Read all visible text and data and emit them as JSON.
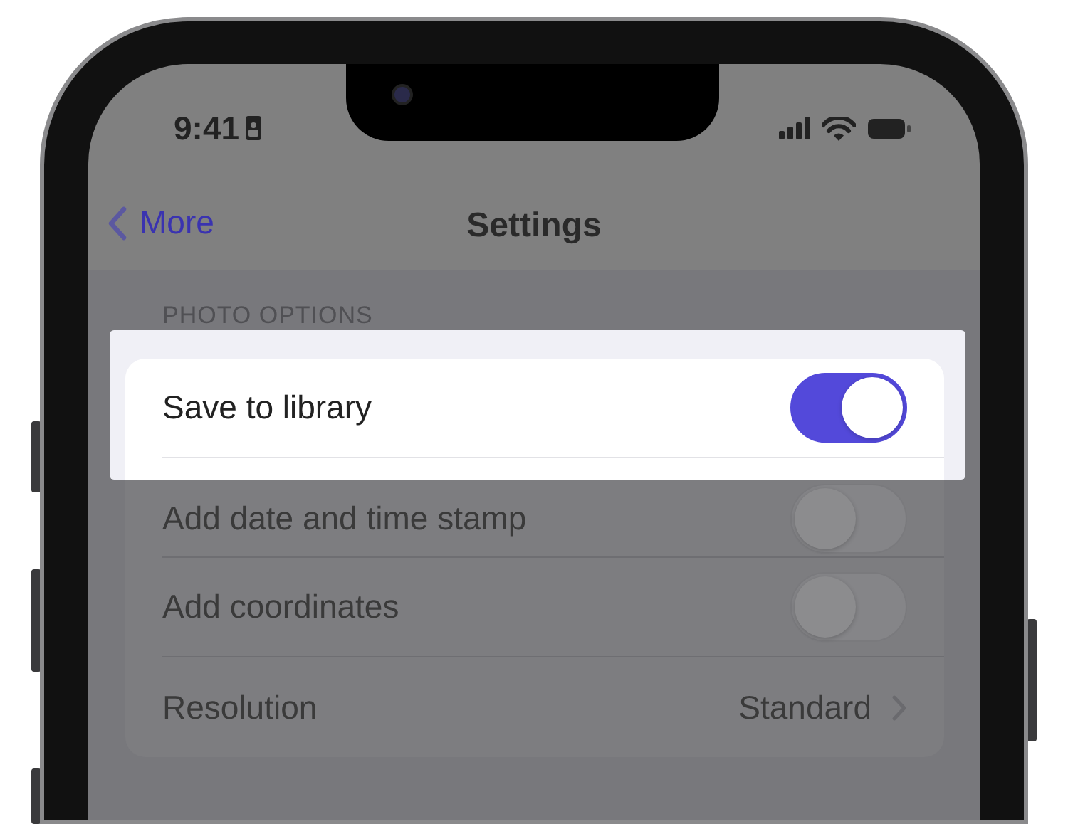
{
  "status_bar": {
    "time": "9:41"
  },
  "nav_bar": {
    "back_label": "More",
    "title": "Settings"
  },
  "section": {
    "header": "PHOTO OPTIONS",
    "rows": [
      {
        "kind": "toggle",
        "label": "Save to library",
        "on": true,
        "highlighted": true
      },
      {
        "kind": "toggle",
        "label": "Add date and time stamp",
        "on": false,
        "highlighted": false
      },
      {
        "kind": "toggle",
        "label": "Add coordinates",
        "on": false,
        "highlighted": false
      },
      {
        "kind": "disclosure",
        "label": "Resolution",
        "value": "Standard",
        "highlighted": false
      }
    ]
  }
}
